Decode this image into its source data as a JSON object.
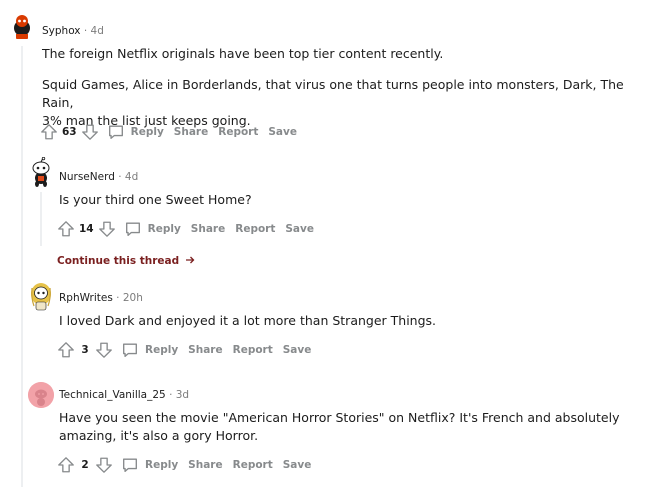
{
  "comments": [
    {
      "author": "Syphox",
      "time": "4d",
      "paragraphs": [
        "The foreign Netflix originals have been top tier content recently.",
        "Squid Games, Alice in Borderlands, that virus one that turns people into monsters, Dark, The Rain,",
        "3% man the list just keeps going."
      ],
      "score": "63",
      "avatar_color": "#1c1c1c"
    },
    {
      "author": "NurseNerd",
      "time": "4d",
      "paragraphs": [
        "Is your third one Sweet Home?"
      ],
      "score": "14",
      "avatar_color": "#e04a1a"
    },
    {
      "author": "RphWrites",
      "time": "20h",
      "paragraphs": [
        "I loved Dark and enjoyed it a lot more than Stranger Things."
      ],
      "score": "3",
      "avatar_color": "#e6c24a"
    },
    {
      "author": "Technical_Vanilla_25",
      "time": "3d",
      "paragraphs": [
        "Have you seen the movie \"American Horror Stories\" on Netflix? It's French and absolutely",
        "amazing, it's also a gory Horror."
      ],
      "score": "2",
      "avatar_color": "#f2a2a8"
    }
  ],
  "separator": "·",
  "actions": {
    "reply": "Reply",
    "share": "Share",
    "report": "Report",
    "save": "Save"
  },
  "continue_thread": "Continue this thread",
  "icons": {
    "upvote": "upvote-arrow-icon",
    "downvote": "downvote-arrow-icon",
    "reply": "speech-bubble-icon",
    "continue": "arrow-right-icon"
  }
}
